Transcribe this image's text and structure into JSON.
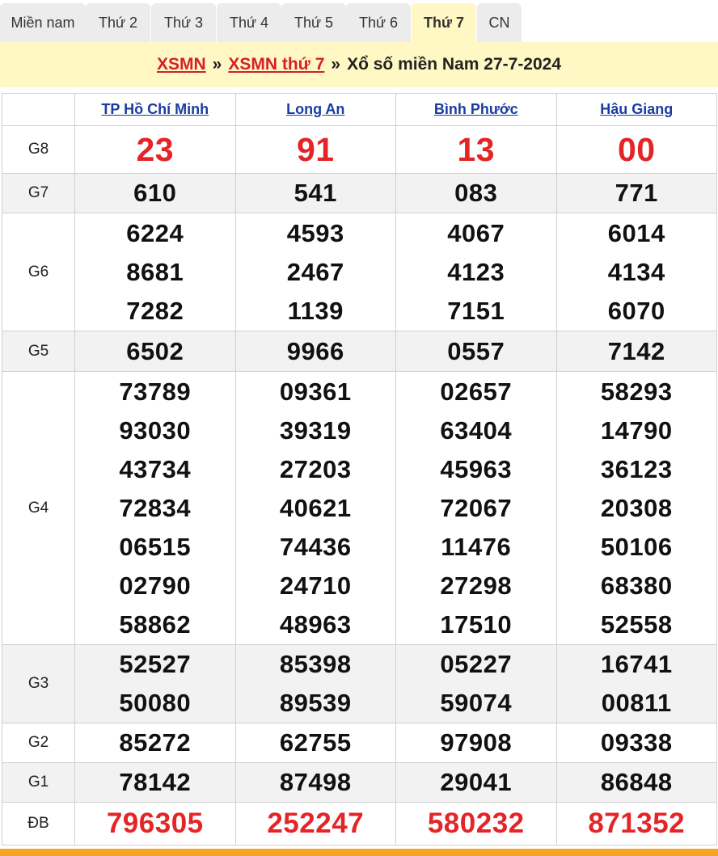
{
  "tabs": [
    {
      "label": "Miền nam",
      "active": false
    },
    {
      "label": "Thứ 2",
      "active": false
    },
    {
      "label": "Thứ 3",
      "active": false
    },
    {
      "label": "Thứ 4",
      "active": false
    },
    {
      "label": "Thứ 5",
      "active": false
    },
    {
      "label": "Thứ 6",
      "active": false
    },
    {
      "label": "Thứ 7",
      "active": true
    },
    {
      "label": "CN",
      "active": false
    }
  ],
  "breadcrumb": {
    "link1": "XSMN",
    "sep1": "»",
    "link2": "XSMN thứ 7",
    "sep2": "»",
    "text": "Xổ số miền Nam 27-7-2024"
  },
  "provinces": [
    "TP Hồ Chí Minh",
    "Long An",
    "Bình Phước",
    "Hậu Giang"
  ],
  "prizes": [
    {
      "label": "G8",
      "results": [
        [
          "23"
        ],
        [
          "91"
        ],
        [
          "13"
        ],
        [
          "00"
        ]
      ]
    },
    {
      "label": "G7",
      "results": [
        [
          "610"
        ],
        [
          "541"
        ],
        [
          "083"
        ],
        [
          "771"
        ]
      ]
    },
    {
      "label": "G6",
      "results": [
        [
          "6224",
          "8681",
          "7282"
        ],
        [
          "4593",
          "2467",
          "1139"
        ],
        [
          "4067",
          "4123",
          "7151"
        ],
        [
          "6014",
          "4134",
          "6070"
        ]
      ]
    },
    {
      "label": "G5",
      "results": [
        [
          "6502"
        ],
        [
          "9966"
        ],
        [
          "0557"
        ],
        [
          "7142"
        ]
      ]
    },
    {
      "label": "G4",
      "results": [
        [
          "73789",
          "93030",
          "43734",
          "72834",
          "06515",
          "02790",
          "58862"
        ],
        [
          "09361",
          "39319",
          "27203",
          "40621",
          "74436",
          "24710",
          "48963"
        ],
        [
          "02657",
          "63404",
          "45963",
          "72067",
          "11476",
          "27298",
          "17510"
        ],
        [
          "58293",
          "14790",
          "36123",
          "20308",
          "50106",
          "68380",
          "52558"
        ]
      ]
    },
    {
      "label": "G3",
      "results": [
        [
          "52527",
          "50080"
        ],
        [
          "85398",
          "89539"
        ],
        [
          "05227",
          "59074"
        ],
        [
          "16741",
          "00811"
        ]
      ]
    },
    {
      "label": "G2",
      "results": [
        [
          "85272"
        ],
        [
          "62755"
        ],
        [
          "97908"
        ],
        [
          "09338"
        ]
      ]
    },
    {
      "label": "G1",
      "results": [
        [
          "78142"
        ],
        [
          "87498"
        ],
        [
          "29041"
        ],
        [
          "86848"
        ]
      ]
    },
    {
      "label": "ĐB",
      "results": [
        [
          "796305"
        ],
        [
          "252247"
        ],
        [
          "580232"
        ],
        [
          "871352"
        ]
      ]
    }
  ],
  "colors": {
    "accent_red": "#e42528",
    "link_blue": "#1a3ca0",
    "header_bg": "#fff7c4",
    "bottom_bar": "#f5a623"
  }
}
